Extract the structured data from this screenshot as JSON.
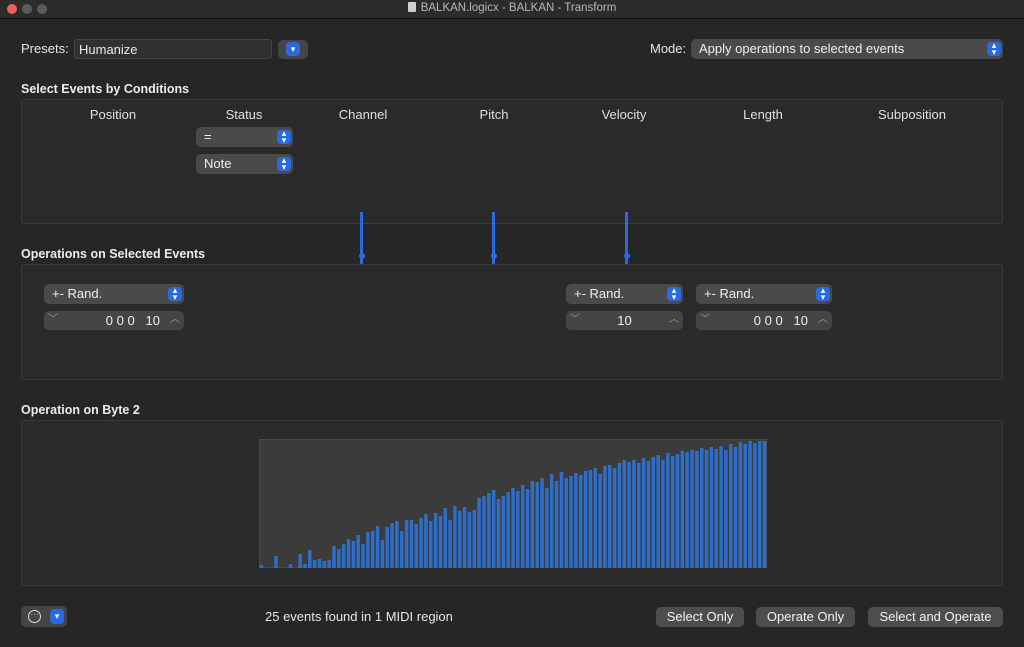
{
  "window": {
    "title": "BALKAN.logicx - BALKAN - Transform"
  },
  "presets": {
    "label": "Presets:",
    "value": "Humanize"
  },
  "mode": {
    "label": "Mode:",
    "value": "Apply operations to selected events"
  },
  "conditions": {
    "header": "Select Events by Conditions",
    "columns": [
      "Position",
      "Status",
      "Channel",
      "Pitch",
      "Velocity",
      "Length",
      "Subposition"
    ],
    "status_operator": "=",
    "status_value": "Note"
  },
  "operations": {
    "header": "Operations on Selected Events",
    "position": {
      "operation": "+- Rand.",
      "value": "0 0 0   10"
    },
    "velocity": {
      "operation": "+- Rand.",
      "value": "10"
    },
    "length": {
      "operation": "+- Rand.",
      "value": "0 0 0   10"
    }
  },
  "byte2": {
    "header": "Operation on Byte 2"
  },
  "chart_data": {
    "type": "bar",
    "title": "",
    "xlabel": "",
    "ylabel": "",
    "ylim": [
      0,
      127
    ],
    "values": [
      3,
      0,
      0,
      12,
      0,
      0,
      4,
      0,
      14,
      4,
      18,
      8,
      9,
      7,
      8,
      22,
      19,
      24,
      29,
      27,
      33,
      24,
      36,
      37,
      42,
      28,
      41,
      45,
      47,
      37,
      48,
      48,
      44,
      50,
      54,
      47,
      55,
      52,
      60,
      48,
      62,
      57,
      61,
      56,
      58,
      70,
      72,
      75,
      78,
      69,
      72,
      76,
      80,
      77,
      83,
      79,
      87,
      86,
      90,
      80,
      94,
      87,
      96,
      90,
      92,
      95,
      93,
      97,
      98,
      100,
      94,
      102,
      103,
      100,
      105,
      108,
      106,
      108,
      105,
      110,
      107,
      111,
      113,
      108,
      115,
      112,
      114,
      117,
      116,
      118,
      117,
      120,
      118,
      121,
      119,
      122,
      118,
      124,
      121,
      126,
      124,
      127,
      125,
      127,
      127
    ],
    "color": "#2e6ec9"
  },
  "footer": {
    "status_text": "25 events found in 1 MIDI region",
    "select_only": "Select Only",
    "operate_only": "Operate Only",
    "select_and_operate": "Select and Operate"
  },
  "colors": {
    "accent": "#2a6ae0",
    "close": "#ee5f57"
  }
}
